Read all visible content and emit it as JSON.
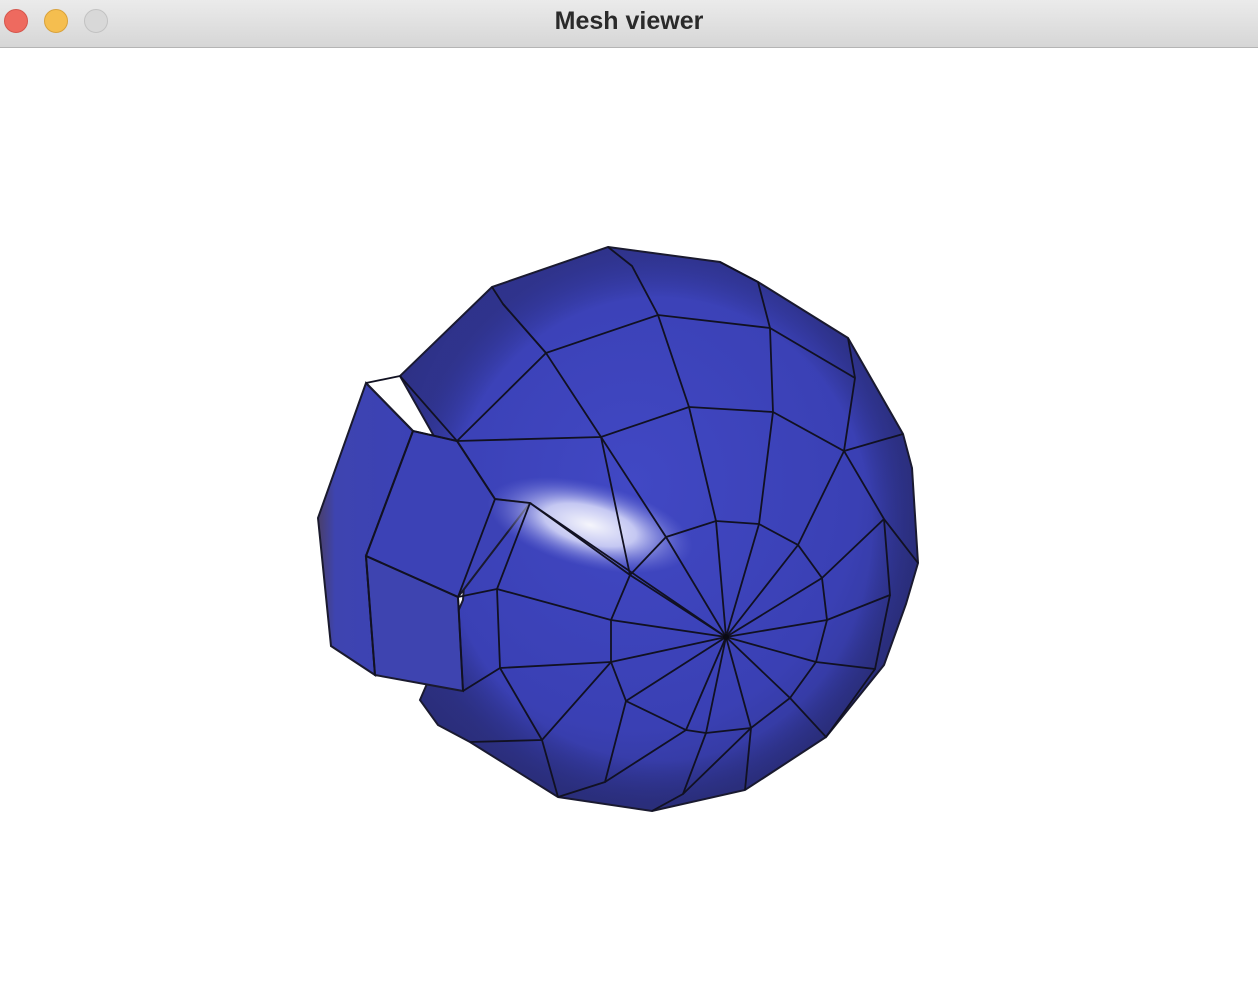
{
  "window": {
    "title": "Mesh viewer"
  },
  "titlebar": {
    "buttons": [
      {
        "name": "close",
        "color": "#ee6a5f"
      },
      {
        "name": "minimize",
        "color": "#f5be4f"
      },
      {
        "name": "zoom",
        "color": "#d8d8d8"
      }
    ]
  },
  "viewport": {
    "background": "#ffffff",
    "mesh": {
      "color": "#3f45bf",
      "wire_color": "#111111"
    }
  }
}
